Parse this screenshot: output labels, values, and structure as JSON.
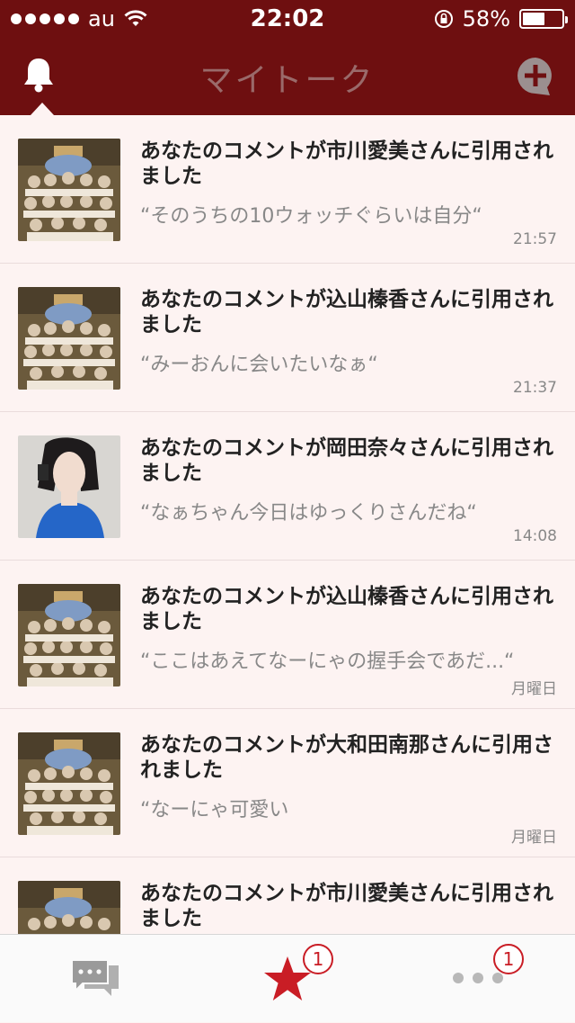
{
  "status_bar": {
    "carrier": "au",
    "time": "22:02",
    "battery_percent": "58%",
    "battery_level": 0.58
  },
  "header": {
    "title": "マイトーク",
    "left_icon": "bell-icon",
    "right_icon": "add-comment-icon"
  },
  "notifications": [
    {
      "title": "あなたのコメントが市川愛美さんに引用されました",
      "quote": "“そのうちの10ウォッチぐらいは自分“",
      "time": "21:57",
      "thumb": "group-photo"
    },
    {
      "title": "あなたのコメントが込山榛香さんに引用されました",
      "quote": "“みーおんに会いたいなぁ“",
      "time": "21:37",
      "thumb": "group-photo"
    },
    {
      "title": "あなたのコメントが岡田奈々さんに引用されました",
      "quote": "“なぁちゃん今日はゆっくりさんだね“",
      "time": "14:08",
      "thumb": "portrait-photo"
    },
    {
      "title": "あなたのコメントが込山榛香さんに引用されました",
      "quote": "“ここはあえてなーにゃの握手会であだ...“",
      "time": "月曜日",
      "thumb": "group-photo"
    },
    {
      "title": "あなたのコメントが大和田南那さんに引用されました",
      "quote": "“なーにゃ可愛い",
      "time": "月曜日",
      "thumb": "group-photo"
    },
    {
      "title": "あなたのコメントが市川愛美さんに引用されました",
      "quote": "",
      "time": "",
      "thumb": "group-photo"
    }
  ],
  "tabbar": {
    "tabs": [
      {
        "icon": "chat-bubbles-icon",
        "badge": ""
      },
      {
        "icon": "star-icon",
        "badge": "1"
      },
      {
        "icon": "more-dots-icon",
        "badge": "1"
      }
    ],
    "accent_color": "#c91d25"
  }
}
